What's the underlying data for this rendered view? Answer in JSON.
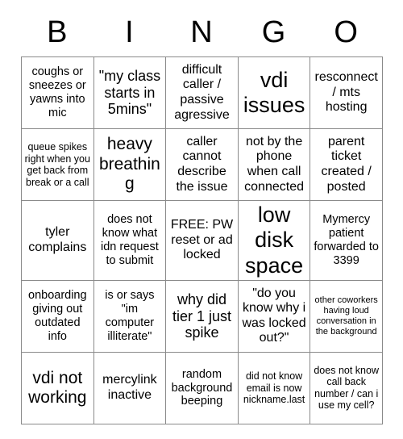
{
  "header": {
    "letters": [
      "B",
      "I",
      "N",
      "G",
      "O"
    ]
  },
  "grid": {
    "columns": 5,
    "rows": 5,
    "border_color": "#8a8a8a",
    "text_color": "#000000",
    "background_color": "#ffffff",
    "cells": [
      {
        "text": "coughs or sneezes or yawns into mic",
        "size": "fs-s"
      },
      {
        "text": "\"my class starts in 5mins\"",
        "size": "fs-l"
      },
      {
        "text": "difficult caller / passive agressive",
        "size": "fs-m"
      },
      {
        "text": "vdi issues",
        "size": "fs-xxl"
      },
      {
        "text": "resconnect / mts hosting",
        "size": "fs-m"
      },
      {
        "text": "queue spikes right when you get back from break or a call",
        "size": "fs-xs"
      },
      {
        "text": "heavy breathing",
        "size": "fs-xl"
      },
      {
        "text": "caller cannot describe the issue",
        "size": "fs-m"
      },
      {
        "text": "not by the phone when call connected",
        "size": "fs-m"
      },
      {
        "text": "parent ticket created / posted",
        "size": "fs-m"
      },
      {
        "text": "tyler complains",
        "size": "fs-m"
      },
      {
        "text": "does not know what idn request to submit",
        "size": "fs-s"
      },
      {
        "text": "FREE: PW reset or ad locked",
        "size": "fs-m"
      },
      {
        "text": "low disk space",
        "size": "fs-xxl"
      },
      {
        "text": "Mymercy patient forwarded to 3399",
        "size": "fs-s"
      },
      {
        "text": "onboarding giving out outdated info",
        "size": "fs-s"
      },
      {
        "text": "is or says \"im computer illiterate\"",
        "size": "fs-s"
      },
      {
        "text": "why did tier 1 just spike",
        "size": "fs-l"
      },
      {
        "text": "\"do you know why i was locked out?\"",
        "size": "fs-m"
      },
      {
        "text": "other coworkers having loud conversation in the background",
        "size": "fs-xxs"
      },
      {
        "text": "vdi not working",
        "size": "fs-xl"
      },
      {
        "text": "mercylink inactive",
        "size": "fs-m"
      },
      {
        "text": "random background beeping",
        "size": "fs-s"
      },
      {
        "text": "did not know email is now nickname.last",
        "size": "fs-xs"
      },
      {
        "text": "does not know call back number / can i use my cell?",
        "size": "fs-xs"
      }
    ]
  }
}
